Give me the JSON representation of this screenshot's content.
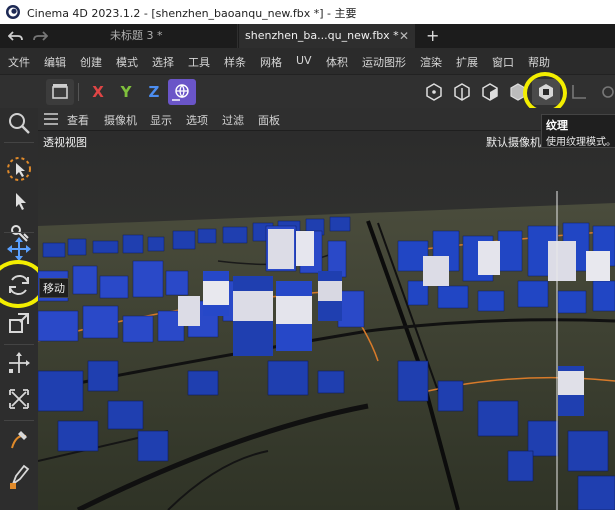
{
  "window": {
    "title": "Cinema 4D 2023.1.2 - [shenzhen_baoanqu_new.fbx *] - 主要"
  },
  "tabs": [
    {
      "label": "未标题 3 *"
    },
    {
      "label": "shenzhen_ba...qu_new.fbx *"
    }
  ],
  "menu": {
    "items": [
      "文件",
      "编辑",
      "创建",
      "模式",
      "选择",
      "工具",
      "样条",
      "网格",
      "UV",
      "体积",
      "运动图形",
      "渲染",
      "扩展",
      "窗口",
      "帮助"
    ]
  },
  "toolbar": {
    "axis_x": "X",
    "axis_y": "Y",
    "axis_z": "Z"
  },
  "viewport": {
    "menu": [
      "查看",
      "摄像机",
      "显示",
      "选项",
      "过滤",
      "面板"
    ],
    "view_label": "透视视图",
    "camera_label": "默认摄像机"
  },
  "tooltips": {
    "texture_title": "纹理",
    "texture_desc": "使用纹理模式。",
    "move_label": "移动"
  },
  "colors": {
    "accent_highlight": "#f3ee00",
    "x_axis": "#e04545",
    "y_axis": "#7fc03c",
    "z_axis": "#4c8df0",
    "building_blue": "#1f3fb0",
    "ground": "#3a3c2c"
  }
}
